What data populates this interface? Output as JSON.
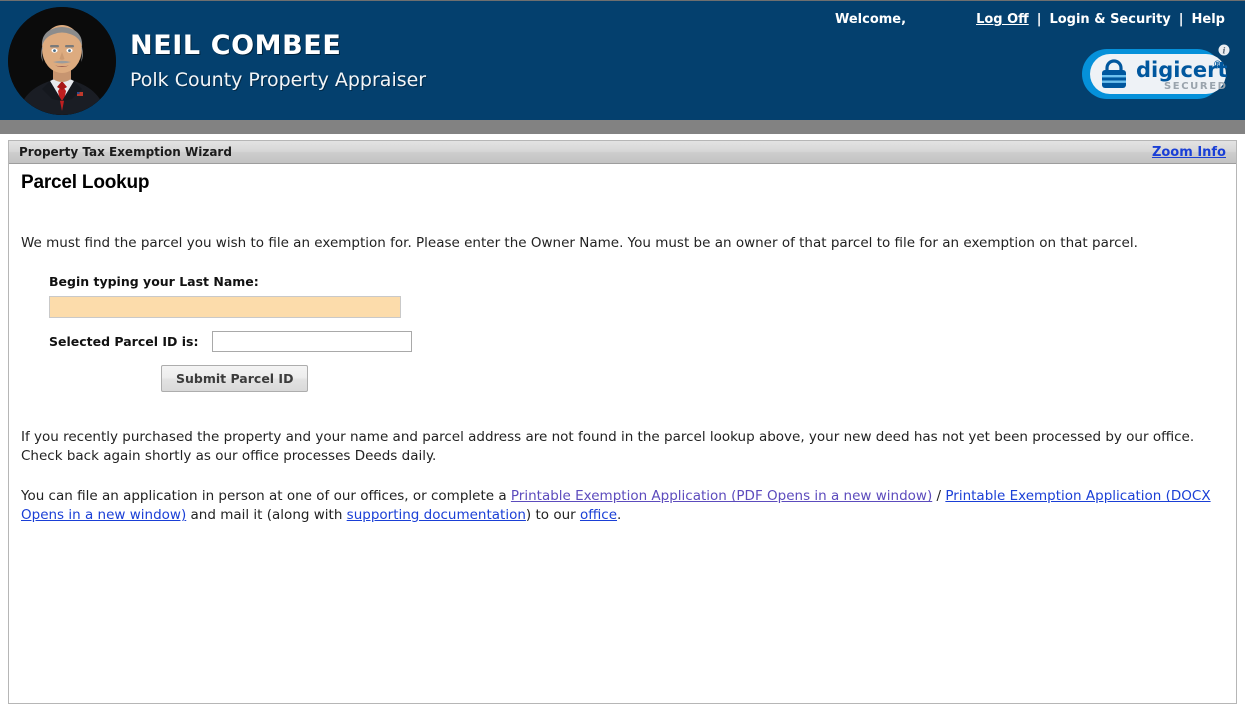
{
  "header": {
    "official_name": "NEIL COMBEE",
    "official_title": "Polk County Property Appraiser",
    "avatar_icon": "portrait-avatar",
    "welcome_label": "Welcome,",
    "nav": {
      "log_off": "Log Off",
      "separator": "|",
      "login_security": "Login & Security",
      "help": "Help"
    },
    "badge": {
      "icon": "padlock-icon",
      "brand": "digicert",
      "brand_mark": "®",
      "subtitle": "SECURED",
      "info_icon": "info-icon"
    },
    "colors": {
      "header_bg": "#04406E",
      "band": "#828282",
      "badge_blue": "#0591DA",
      "badge_navy": "#00579E"
    }
  },
  "panel": {
    "wizard_title": "Property Tax Exemption Wizard",
    "zoom_info_link": "Zoom Info",
    "page_title": "Parcel Lookup",
    "intro": "We must find the parcel you wish to file an exemption for. Please enter the Owner Name. You must be an owner of that parcel to file for an exemption on that parcel.",
    "form": {
      "lastname_label": "Begin typing your Last Name:",
      "lastname_value": "",
      "lastname_placeholder": "",
      "lastname_bg_color": "#FCDCAB",
      "parcel_label": "Selected Parcel ID is:",
      "parcel_value": "",
      "parcel_placeholder": "",
      "submit_label": "Submit Parcel ID"
    },
    "note": "If you recently purchased the property and your name and parcel address are not found in the parcel lookup above, your new deed has not yet been processed by our office. Check back again shortly as our office processes Deeds daily.",
    "links_paragraph": {
      "part1": "You can file an application in person at one of our offices, or complete a ",
      "link_pdf": "Printable Exemption Application (PDF Opens in a new window)",
      "part2": " / ",
      "link_docx": "Printable Exemption Application (DOCX Opens in a new window)",
      "part3": " and mail it (along with ",
      "link_docs": "supporting documentation",
      "part4": ") to our ",
      "link_office": "office",
      "part5": "."
    }
  }
}
